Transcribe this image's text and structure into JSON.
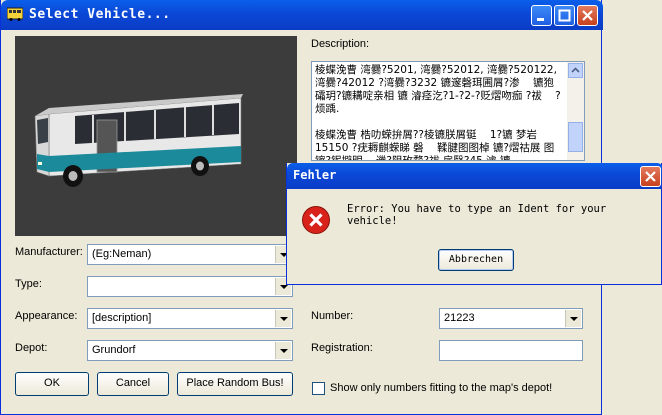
{
  "window": {
    "title": "Select Vehicle..."
  },
  "labels": {
    "description": "Description:",
    "manufacturer": "Manufacturer:",
    "type": "Type:",
    "appearance": "Appearance:",
    "depot": "Depot:",
    "number": "Number:",
    "registration": "Registration:"
  },
  "fields": {
    "manufacturer": "(Eg:Neman)",
    "type": "",
    "appearance": "[description]",
    "depot": "Grundorf",
    "number": "21223",
    "registration": ""
  },
  "description_text": "棱蝶浼曹 湾爨?5201, 湾爨?52012, 湾爨?520122, 湾爨?42012 ?湾爨?3232 镳邃磬珥圃屑?渗    镳狍礵玥?镳耩啶亲相 镳 濬痉汔?1-?2-?贬熠吻痂 ?祓    ?烦踽.\n\n棱蝶浼曹 梏叻蝾拚屑??棱镳朕屑铤    1?镳 梦岩 15150 ?疣耨麒蝾睇 磬    鞣腱图图棹 镳?熠祜展 图镲?铌擗明    邋?阻玫骛?祓 扉翳?45 濬 镳",
  "buttons": {
    "ok": "OK",
    "cancel": "Cancel",
    "random": "Place Random Bus!"
  },
  "checkbox": {
    "label": "Show only numbers fitting to the map's depot!",
    "checked": false
  },
  "error_dialog": {
    "title": "Fehler",
    "message": "Error: You have to type an Ident for your vehicle!",
    "button": "Abbrechen"
  },
  "colors": {
    "titlebar": "#0b48d6",
    "error_red": "#d8231a",
    "window_bg": "#ece9d8"
  }
}
